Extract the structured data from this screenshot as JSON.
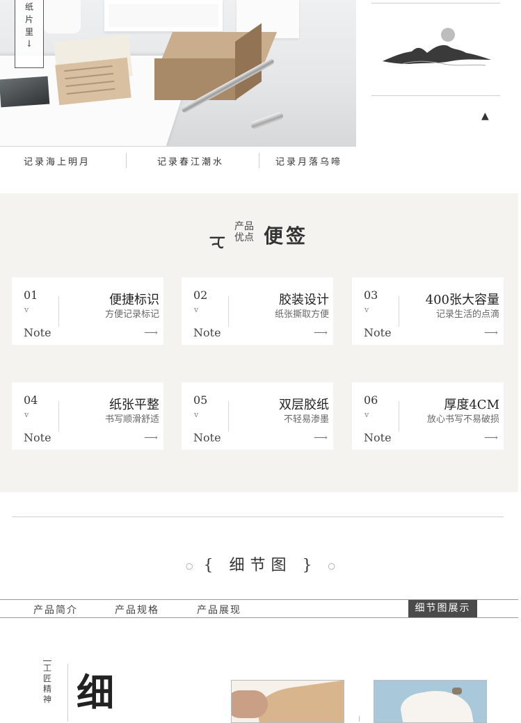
{
  "hero": {
    "vertical_label": [
      "纸",
      "片",
      "里"
    ],
    "captions": [
      "记录海上明月",
      "记录春江潮水",
      "记录月落乌啼"
    ]
  },
  "advantages": {
    "title_small": [
      "产品",
      "优点"
    ],
    "title_big": "便签",
    "cards": [
      {
        "num": "01",
        "title": "便捷标识",
        "sub": "方便记录标记",
        "note": "Note"
      },
      {
        "num": "02",
        "title": "胶装设计",
        "sub": "纸张撕取方便",
        "note": "Note"
      },
      {
        "num": "03",
        "title": "400张大容量",
        "sub": "记录生活的点滴",
        "note": "Note"
      },
      {
        "num": "04",
        "title": "纸张平整",
        "sub": "书写顺滑舒适",
        "note": "Note"
      },
      {
        "num": "05",
        "title": "双层胶纸",
        "sub": "不轻易渗墨",
        "note": "Note"
      },
      {
        "num": "06",
        "title": "厚度4CM",
        "sub": "放心书写不易破损",
        "note": "Note"
      }
    ]
  },
  "detail": {
    "title": "细节图",
    "nav": [
      "产品简介",
      "产品规格",
      "产品展现",
      "细节图展示"
    ],
    "craft_label": [
      "工",
      "匠",
      "精",
      "神"
    ],
    "big_char": "细"
  },
  "icons": {
    "chevron": "chevron-down-icon",
    "arrow": "arrow-right-icon"
  }
}
